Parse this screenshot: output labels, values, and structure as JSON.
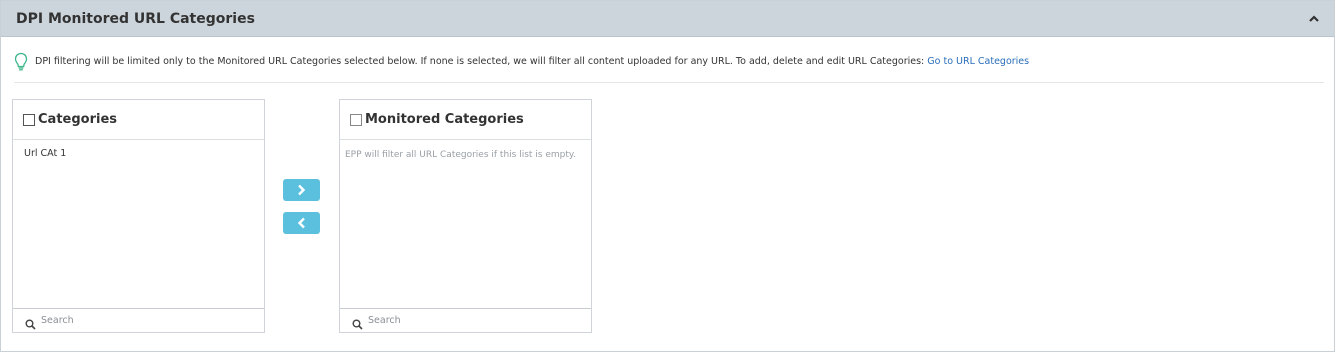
{
  "panel": {
    "title": "DPI Monitored URL Categories",
    "collapse_icon": "chevron-up-icon"
  },
  "info": {
    "icon": "lightbulb-icon",
    "text": "DPI filtering will be limited only to the Monitored URL Categories selected below. If none is selected, we will filter all content uploaded for any URL. To add, delete and edit URL Categories: ",
    "link_label": "Go to URL Categories"
  },
  "categories": {
    "title": "Categories",
    "items": [
      "Url CAt 1"
    ],
    "search": {
      "placeholder": "Search",
      "value": ""
    }
  },
  "monitored": {
    "title": "Monitored Categories",
    "empty_message": "EPP will filter all URL Categories if this list is empty.",
    "search": {
      "placeholder": "Search",
      "value": ""
    }
  },
  "buttons": {
    "move_right_icon": "chevron-right-icon",
    "move_left_icon": "chevron-left-icon"
  },
  "colors": {
    "header_bg": "#cdd5dc",
    "button_bg": "#5bc0de",
    "link": "#2a6ebb",
    "bulb": "#3fb68b"
  }
}
